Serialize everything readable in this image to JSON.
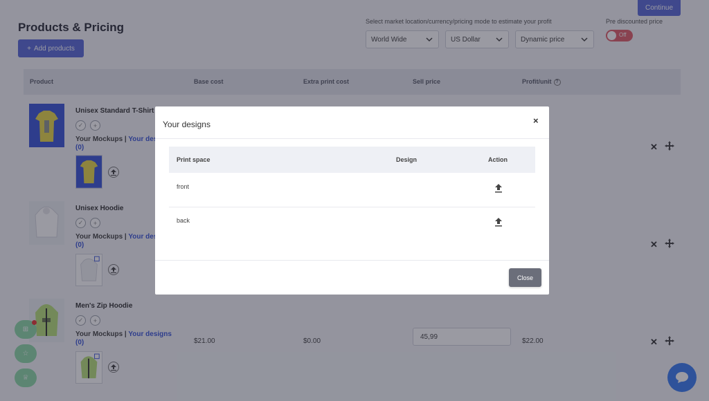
{
  "header": {
    "continue_label": "Continue",
    "title": "Products & Pricing",
    "add_products_label": "Add products",
    "market_label": "Select market location/currency/pricing mode to estimate your profit",
    "location_select": "World Wide",
    "currency_select": "US Dollar",
    "pricing_select": "Dynamic price",
    "pre_discounted_label": "Pre discounted price",
    "toggle_label": "Off"
  },
  "table": {
    "headers": [
      "Product",
      "Base cost",
      "Extra print cost",
      "Sell price",
      "Profit/unit"
    ]
  },
  "products": [
    {
      "name": "Unisex Standard T-Shirt",
      "mockups_label": "Your Mockups",
      "designs_label": "Your designs",
      "count": "(0)"
    },
    {
      "name": "Unisex Hoodie",
      "mockups_label": "Your Mockups",
      "designs_label": "Your designs",
      "count": "(0)"
    },
    {
      "name": "Men's Zip Hoodie",
      "mockups_label": "Your Mockups",
      "designs_label": "Your designs",
      "count": "(0)",
      "base_cost": "$21.00",
      "extra_print_cost": "$0.00",
      "sell_price": "45,99",
      "profit": "$22.00"
    }
  ],
  "modal": {
    "title": "Your designs",
    "close_x": "×",
    "headers": [
      "Print space",
      "Design",
      "Action"
    ],
    "rows": [
      {
        "print_space": "front"
      },
      {
        "print_space": "back"
      }
    ],
    "close_label": "Close"
  },
  "colors": {
    "accent": "#5a6ad8",
    "toggle_off": "#e0606b",
    "side_buttons": "#8fd9a8",
    "chat": "#3b7cf0",
    "link": "#3b56d8"
  }
}
